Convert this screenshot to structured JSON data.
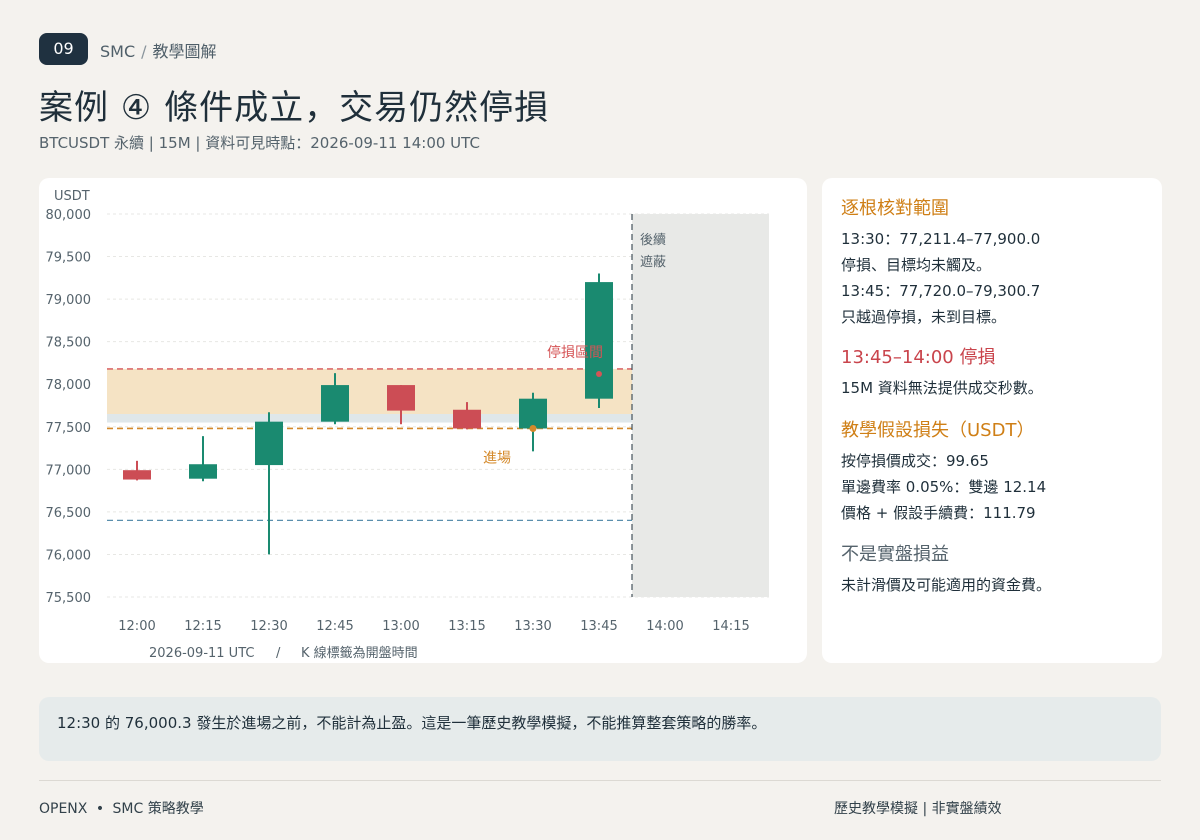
{
  "header": {
    "badge": "09",
    "breadcrumb_brand": "SMC",
    "breadcrumb_sep": "/",
    "breadcrumb_section": "教學圖解",
    "title": "案例 ④  條件成立，交易仍然停損",
    "subtitle": "BTCUSDT 永續 | 15M | 資料可見時點：2026-09-11 14:00 UTC"
  },
  "colors": {
    "bull": "#1a8a70",
    "bear": "#cc4d55",
    "entry": "#d4892a",
    "stop": "#d55456",
    "target": "#5a8fad",
    "zone": "#f5e3c4",
    "zone_lower": "#dfe7ea",
    "mask": "#e8e9e7",
    "accent_orange": "#cf7f16",
    "accent_red": "#c9444c",
    "muted": "#55636c"
  },
  "chart_data": {
    "type": "candlestick",
    "y_unit": "USDT",
    "ylim": [
      75500,
      80000
    ],
    "y_ticks": [
      "80,000",
      "79,500",
      "79,000",
      "78,500",
      "78,000",
      "77,500",
      "77,000",
      "76,500",
      "76,000",
      "75,500"
    ],
    "y_tick_values": [
      80000,
      79500,
      79000,
      78500,
      78000,
      77500,
      77000,
      76500,
      76000,
      75500
    ],
    "x_ticks": [
      "12:00",
      "12:15",
      "12:30",
      "12:45",
      "13:00",
      "13:15",
      "13:30",
      "13:45",
      "14:00",
      "14:15"
    ],
    "xlabel_date": "2026-09-11 UTC",
    "xlabel_sep": "/",
    "xlabel_note": "K 線標籤為開盤時間",
    "grid": true,
    "candles": [
      {
        "time": "12:00",
        "open": 76990,
        "high": 77100,
        "low": 76870,
        "close": 76880
      },
      {
        "time": "12:15",
        "open": 76890,
        "high": 77390,
        "low": 76860,
        "close": 77060
      },
      {
        "time": "12:30",
        "open": 77050,
        "high": 77670,
        "low": 76000.3,
        "close": 77560
      },
      {
        "time": "12:45",
        "open": 77560,
        "high": 78130,
        "low": 77530,
        "close": 77990
      },
      {
        "time": "13:00",
        "open": 77990,
        "high": 77990,
        "low": 77530,
        "close": 77690
      },
      {
        "time": "13:15",
        "open": 77700,
        "high": 77790,
        "low": 77470,
        "close": 77480
      },
      {
        "time": "13:30",
        "open": 77480,
        "high": 77900,
        "low": 77211.4,
        "close": 77830
      },
      {
        "time": "13:45",
        "open": 77830,
        "high": 79300.7,
        "low": 77720,
        "close": 79200
      }
    ],
    "levels": {
      "entry": 77480,
      "stop": 78180,
      "target": 76400,
      "zone_top": 78180,
      "zone_mid": 77650,
      "zone_bottom": 77550
    },
    "markers": {
      "entry_point": {
        "time": "13:30",
        "value": 77480
      },
      "stop_point": {
        "time": "13:45",
        "value": 78120
      }
    },
    "labels": {
      "entry": "進場",
      "stop_zone": "停損區間",
      "masked_line1": "後續",
      "masked_line2": "遮蔽"
    },
    "cutoff_time": "14:00"
  },
  "side": {
    "s1_title": "逐根核對範圍",
    "s1_l1": "13:30：77,211.4–77,900.0",
    "s1_l2": "停損、目標均未觸及。",
    "s1_l3": "13:45：77,720.0–79,300.7",
    "s1_l4": "只越過停損，未到目標。",
    "s2_title": "13:45–14:00 停損",
    "s2_l1": "15M 資料無法提供成交秒數。",
    "s3_title": "教學假設損失（USDT）",
    "s3_l1": "按停損價成交：99.65",
    "s3_l2": "單邊費率 0.05%：雙邊 12.14",
    "s3_l3": "價格 + 假設手續費：111.79",
    "s4_title": "不是實盤損益",
    "s4_l1": "未計滑價及可能適用的資金費。"
  },
  "note": {
    "text": "12:30 的 76,000.3 發生於進場之前，不能計為止盈。這是一筆歷史教學模擬，不能推算整套策略的勝率。"
  },
  "footer": {
    "left_brand": "OPENX",
    "left_dot": "•",
    "left_label": "SMC 策略教學",
    "right": "歷史教學模擬 | 非實盤績效"
  }
}
